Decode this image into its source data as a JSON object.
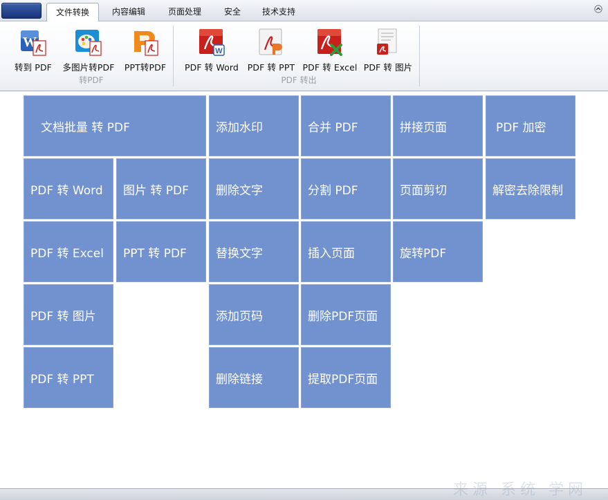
{
  "tabs": [
    {
      "label": "文件转换",
      "active": true
    },
    {
      "label": "内容编辑",
      "active": false
    },
    {
      "label": "页面处理",
      "active": false
    },
    {
      "label": "安全",
      "active": false
    },
    {
      "label": "技术支持",
      "active": false
    }
  ],
  "ribbon": {
    "group1": {
      "label": "转PDF",
      "buttons": [
        {
          "label": "转到 PDF",
          "icon": "word-to-pdf-icon"
        },
        {
          "label": "多图片转PDF",
          "icon": "images-to-pdf-icon"
        },
        {
          "label": "PPT转PDF",
          "icon": "ppt-to-pdf-icon"
        }
      ]
    },
    "group2": {
      "label": "PDF 转出",
      "buttons": [
        {
          "label": "PDF 转 Word",
          "icon": "pdf-to-word-icon"
        },
        {
          "label": "PDF 转 PPT",
          "icon": "pdf-to-ppt-icon"
        },
        {
          "label": "PDF 转 Excel",
          "icon": "pdf-to-excel-icon"
        },
        {
          "label": "PDF 转 图片",
          "icon": "pdf-to-image-icon"
        }
      ]
    }
  },
  "tiles": {
    "batch_to_pdf": "文档批量 转 PDF",
    "pdf_to_word": "PDF 转 Word",
    "image_to_pdf": "图片 转 PDF",
    "pdf_to_excel": "PDF 转 Excel",
    "ppt_to_pdf": "PPT 转 PDF",
    "pdf_to_image": "PDF 转 图片",
    "pdf_to_ppt": "PDF 转 PPT",
    "add_watermark": "添加水印",
    "delete_text": "删除文字",
    "replace_text": "替换文字",
    "add_page_number": "添加页码",
    "delete_link": "删除链接",
    "merge_pdf": "合并 PDF",
    "split_pdf": "分割 PDF",
    "insert_page": "插入页面",
    "delete_pdf_page": "删除PDF页面",
    "extract_pdf_page": "提取PDF页面",
    "join_pages": "拼接页面",
    "crop_page": "页面剪切",
    "rotate_pdf": "旋转PDF",
    "pdf_encrypt": "PDF 加密",
    "decrypt_remove_limit": "解密去除限制"
  },
  "watermark": "来源 系统 学网",
  "colors": {
    "tile": "#7192cf",
    "tile_border": "#8aa6d9",
    "pdf_red": "#c8201c"
  }
}
